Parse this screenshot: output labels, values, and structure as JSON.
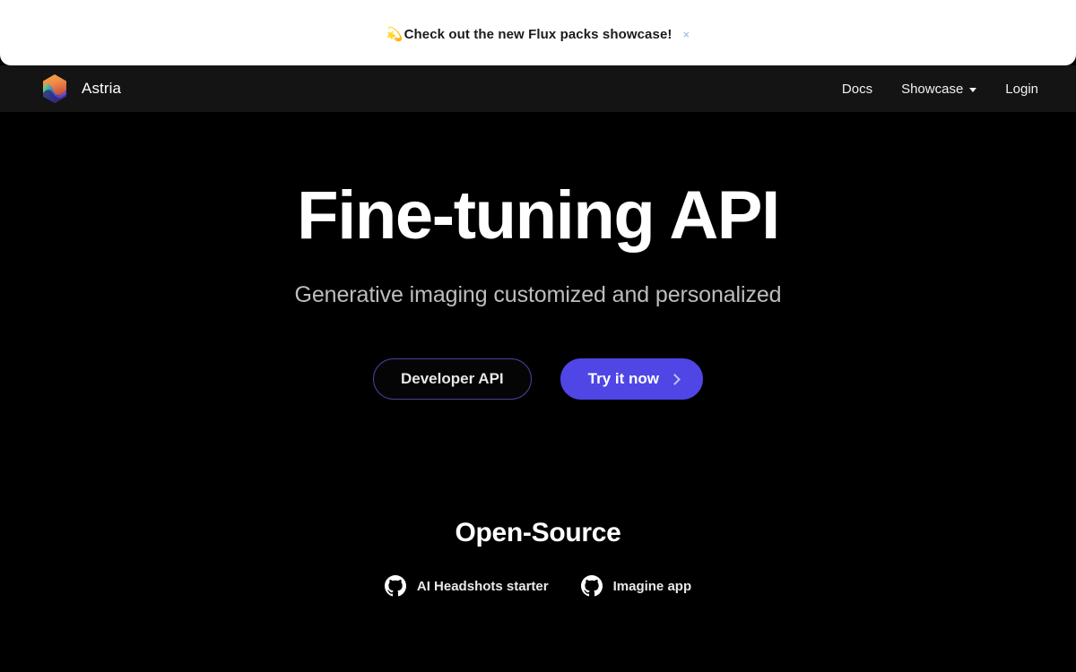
{
  "banner": {
    "icon": "💫",
    "icon_name": "comet-icon",
    "text": "Check out the new Flux packs showcase!",
    "close_label": "×",
    "background": "#ffffff",
    "text_color": "#1b1b1b",
    "close_color": "#8fb3e0"
  },
  "navbar": {
    "background": "#141414",
    "brand": {
      "name": "Astria",
      "logo_name": "astria-hexagon-logo"
    },
    "links": [
      {
        "label": "Docs",
        "has_caret": false
      },
      {
        "label": "Showcase",
        "has_caret": true
      },
      {
        "label": "Login",
        "has_caret": false
      }
    ]
  },
  "hero": {
    "title": "Fine-tuning API",
    "subtitle": "Generative imaging customized and personalized",
    "buttons": [
      {
        "label": "Developer API",
        "style": "outline",
        "border_color": "#4b3fa0"
      },
      {
        "label": "Try it now",
        "style": "primary",
        "background": "#4f46e5",
        "chevron": true
      }
    ]
  },
  "open_source": {
    "title": "Open-Source",
    "links": [
      {
        "label": "AI Headshots starter",
        "icon": "github-icon"
      },
      {
        "label": "Imagine app",
        "icon": "github-icon"
      }
    ]
  },
  "page": {
    "background": "#000000"
  }
}
